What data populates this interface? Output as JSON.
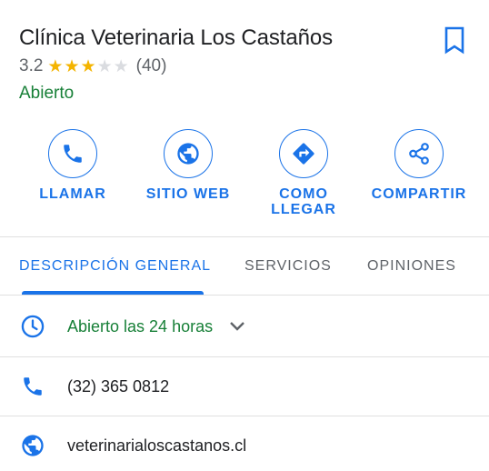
{
  "place": {
    "name": "Clínica Veterinaria Los Castaños",
    "rating_value": "3.2",
    "stars_filled": 3,
    "stars_total": 5,
    "review_count": "(40)",
    "status": "Abierto"
  },
  "actions": [
    {
      "label": "LLAMAR",
      "icon": "phone-icon"
    },
    {
      "label": "SITIO WEB",
      "icon": "globe-icon"
    },
    {
      "label": "COMO\nLLEGAR",
      "icon": "directions-icon"
    },
    {
      "label": "COMPARTIR",
      "icon": "share-icon"
    }
  ],
  "tabs": [
    {
      "label": "DESCRIPCIÓN GENERAL",
      "active": true
    },
    {
      "label": "SERVICIOS",
      "active": false
    },
    {
      "label": "OPINIONES",
      "active": false
    }
  ],
  "info": {
    "hours": "Abierto las 24 horas",
    "phone": "(32) 365 0812",
    "website": "veterinarialoscastanos.cl"
  },
  "colors": {
    "accent": "#1a73e8",
    "open_green": "#188038",
    "star": "#f4b400",
    "text": "#202124",
    "muted": "#5f6368"
  }
}
